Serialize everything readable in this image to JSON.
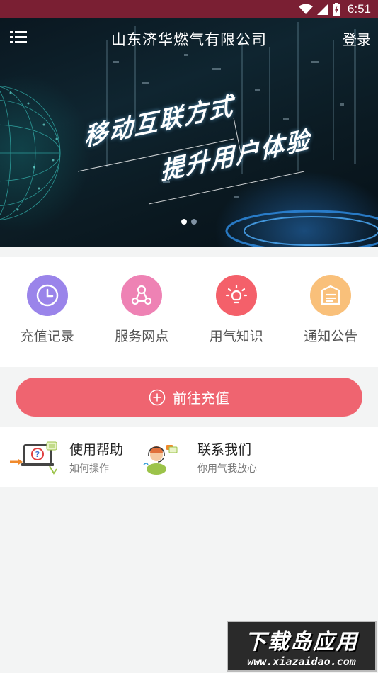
{
  "status_bar": {
    "time": "6:51",
    "icons": [
      "wifi-icon",
      "signal-icon",
      "battery-charging-icon"
    ]
  },
  "header": {
    "title": "山东济华燃气有限公司",
    "login_label": "登录",
    "menu_icon": "menu-icon"
  },
  "banner": {
    "slogan_line1": "移动互联方式",
    "slogan_line2": "提升用户体验",
    "slide_count": 2,
    "active_slide": 1
  },
  "features": [
    {
      "label": "充值记录",
      "icon": "clock-icon",
      "color": "#9a84ea"
    },
    {
      "label": "服务网点",
      "icon": "network-nodes-icon",
      "color": "#ee82b4"
    },
    {
      "label": "用气知识",
      "icon": "lightbulb-icon",
      "color": "#f4606a"
    },
    {
      "label": "通知公告",
      "icon": "notice-board-icon",
      "color": "#f9c07a"
    }
  ],
  "recharge": {
    "label": "前往充值",
    "icon": "plus-circle-icon",
    "color": "#ef6470"
  },
  "help": [
    {
      "title": "使用帮助",
      "subtitle": "如何操作",
      "icon": "laptop-help-icon"
    },
    {
      "title": "联系我们",
      "subtitle": "你用气我放心",
      "icon": "customer-service-icon"
    }
  ],
  "watermark": {
    "title": "下载岛应用",
    "url": "www.xiazaidao.com"
  }
}
